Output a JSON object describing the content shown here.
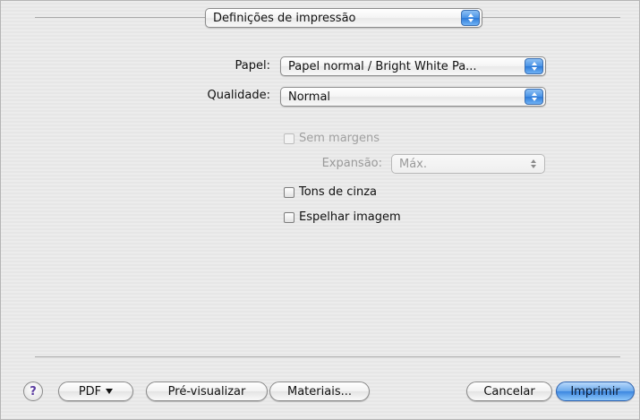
{
  "header": {
    "panel_selector": "Definições de impressão"
  },
  "form": {
    "paper_label": "Papel:",
    "paper_value": "Papel normal / Bright White Pa...",
    "quality_label": "Qualidade:",
    "quality_value": "Normal",
    "borderless_label": "Sem margens",
    "expansion_label": "Expansão:",
    "expansion_value": "Máx.",
    "grayscale_label": "Tons de cinza",
    "mirror_label": "Espelhar imagem"
  },
  "footer": {
    "help_glyph": "?",
    "pdf_label": "PDF",
    "preview_label": "Pré-visualizar",
    "supplies_label": "Materiais...",
    "cancel_label": "Cancelar",
    "print_label": "Imprimir"
  },
  "icons": {
    "popup": "up-down-arrows-icon",
    "help": "question-mark-icon",
    "pdf_menu": "caret-down-icon"
  },
  "colors": {
    "accent_blue": "#3c87e0",
    "background": "#ececec"
  }
}
